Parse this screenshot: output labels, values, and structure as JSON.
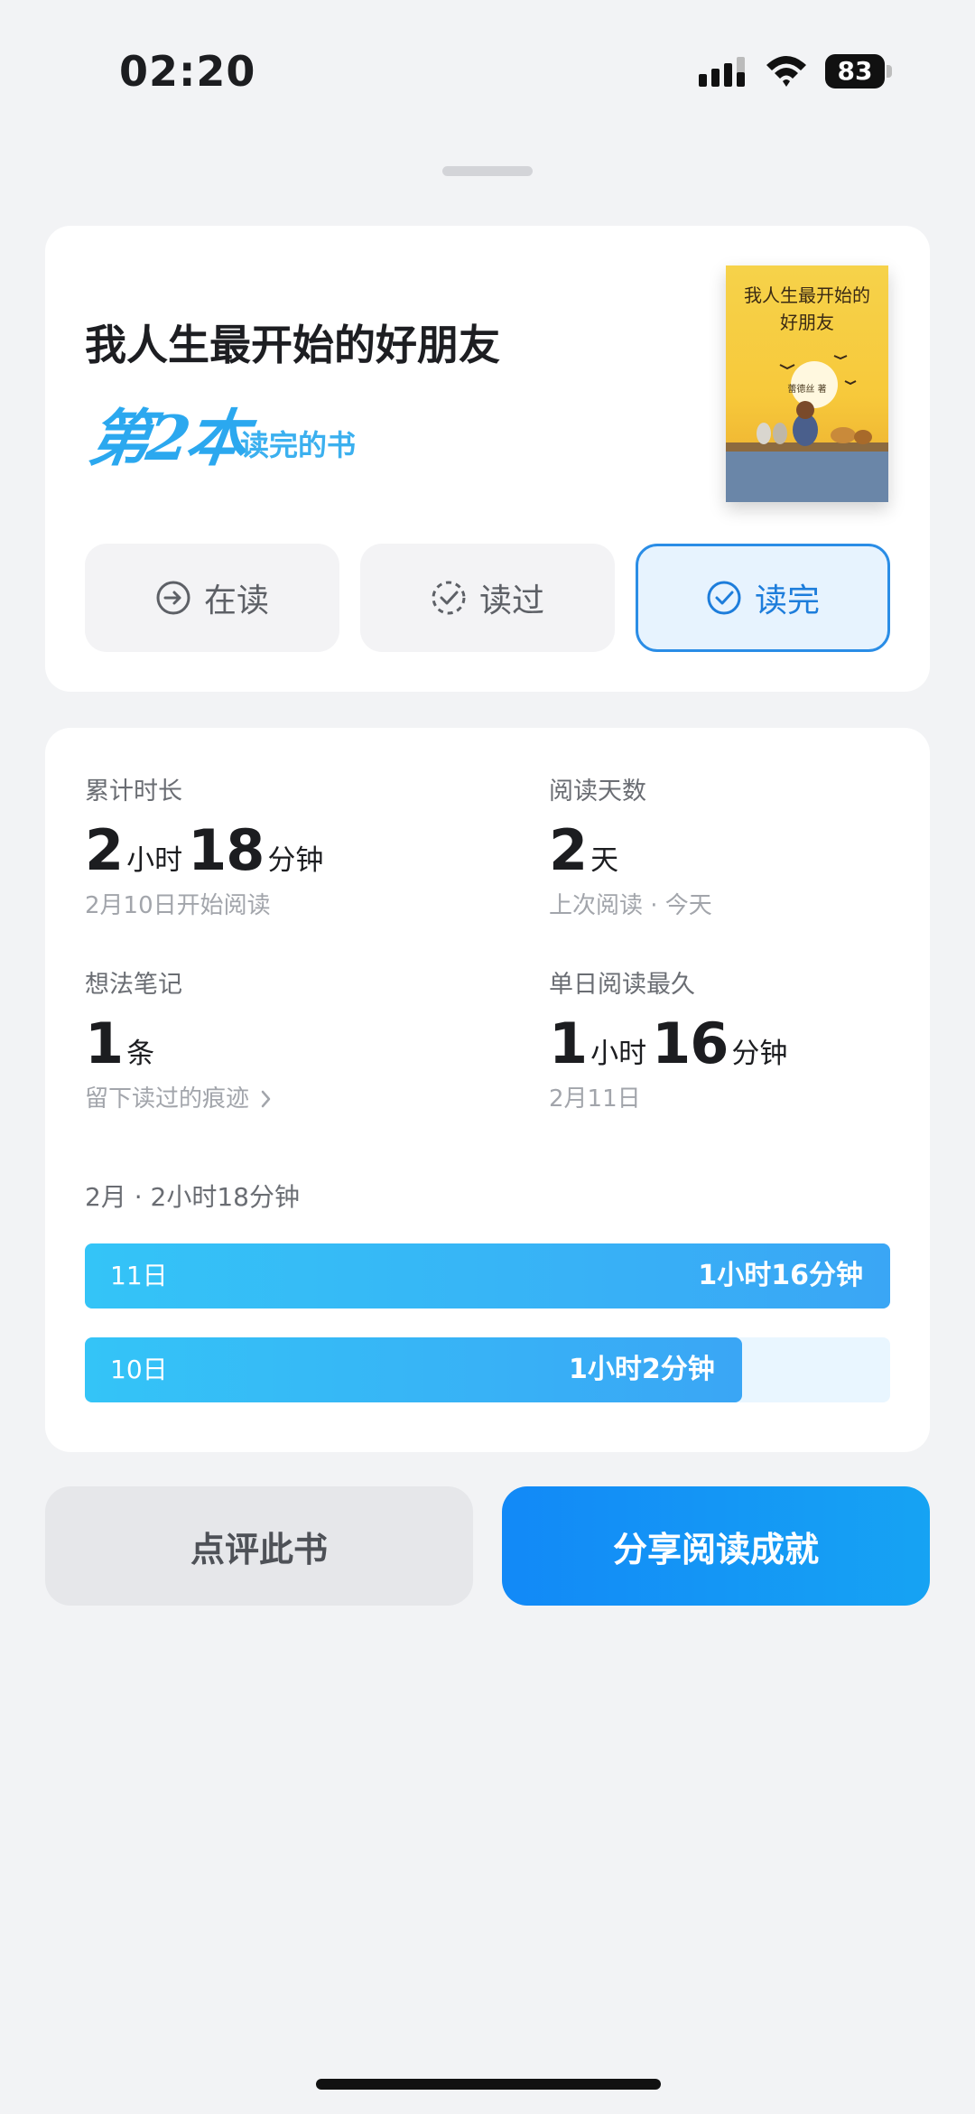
{
  "status_bar": {
    "time": "02:20",
    "battery": "83"
  },
  "book": {
    "title": "我人生最开始的好朋友",
    "rank_big": "第2本",
    "rank_small": "读完的书",
    "cover_title_line1": "我人生最开始的",
    "cover_title_line2": "好朋友",
    "cover_author": "蕾德丝 著"
  },
  "status_tabs": [
    {
      "label": "在读",
      "icon": "arrow-circle-icon",
      "active": false
    },
    {
      "label": "读过",
      "icon": "dashed-check-circle-icon",
      "active": false
    },
    {
      "label": "读完",
      "icon": "check-circle-icon",
      "active": true
    }
  ],
  "stats": {
    "total_time": {
      "label": "累计时长",
      "h": "2",
      "h_unit": "小时",
      "m": "18",
      "m_unit": "分钟",
      "sub": "2月10日开始阅读"
    },
    "days": {
      "label": "阅读天数",
      "value": "2",
      "unit": "天",
      "sub": "上次阅读 · 今天"
    },
    "notes": {
      "label": "想法笔记",
      "value": "1",
      "unit": "条",
      "sub": "留下读过的痕迹"
    },
    "longest_day": {
      "label": "单日阅读最久",
      "h": "1",
      "h_unit": "小时",
      "m": "16",
      "m_unit": "分钟",
      "sub": "2月11日"
    }
  },
  "monthly": {
    "label": "2月 · 2小时18分钟",
    "bars": [
      {
        "day": "11日",
        "value": "1小时16分钟",
        "fraction": 1.0
      },
      {
        "day": "10日",
        "value": "1小时2分钟",
        "fraction": 0.8158
      }
    ]
  },
  "actions": {
    "review": "点评此书",
    "share": "分享阅读成就"
  },
  "colors": {
    "accent": "#1d7ddb",
    "bar": "#34c4f7",
    "share_button": "#1289f7"
  }
}
